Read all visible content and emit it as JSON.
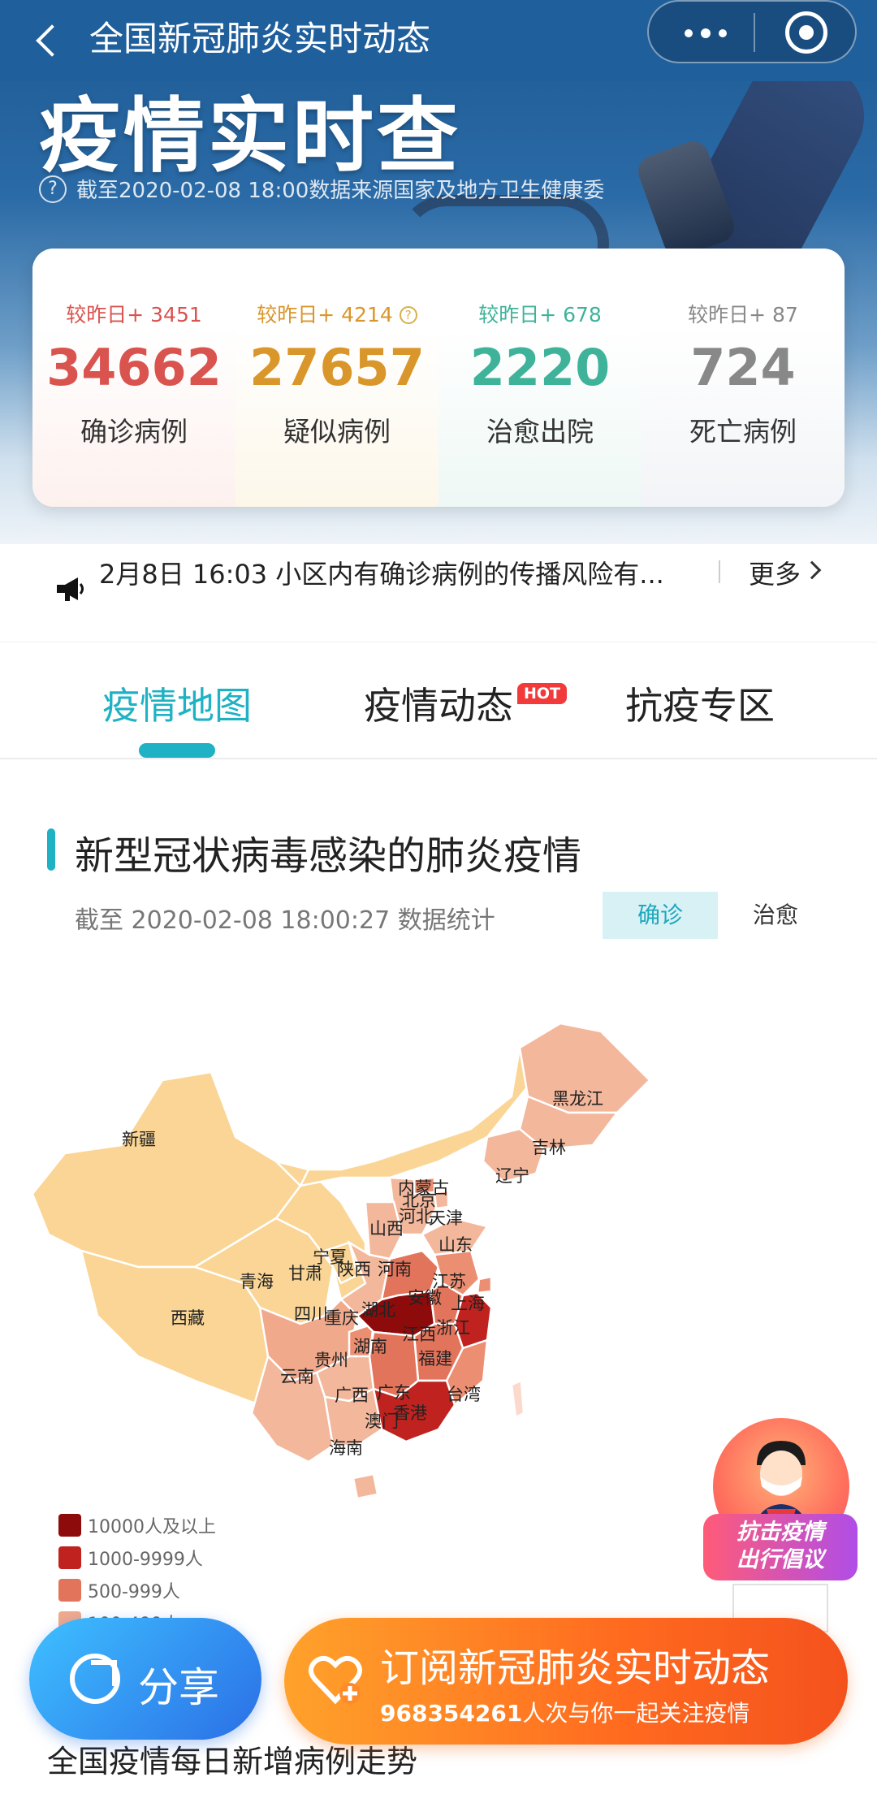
{
  "nav": {
    "title": "全国新冠肺炎实时动态"
  },
  "hero": {
    "title": "疫情实时查",
    "info": "截至2020-02-08 18:00数据来源国家及地方卫生健康委"
  },
  "stats": [
    {
      "delta": "较昨日+ 3451",
      "value": "34662",
      "label": "确诊病例",
      "color": "#d9534f"
    },
    {
      "delta": "较昨日+ 4214",
      "value": "27657",
      "label": "疑似病例",
      "color": "#d9962a"
    },
    {
      "delta": "较昨日+ 678",
      "value": "2220",
      "label": "治愈出院",
      "color": "#3fb39a"
    },
    {
      "delta": "较昨日+ 87",
      "value": "724",
      "label": "死亡病例",
      "color": "#888888"
    }
  ],
  "news": {
    "text": "2月8日 16:03 小区内有确诊病例的传播风险有...",
    "more": "更多"
  },
  "tabs": [
    {
      "label": "疫情地图",
      "active": true
    },
    {
      "label": "疫情动态",
      "badge": "HOT"
    },
    {
      "label": "抗疫专区"
    }
  ],
  "section": {
    "title": "新型冠状病毒感染的肺炎疫情",
    "date": "截至 2020-02-08 18:00:27 数据统计",
    "toggle": [
      "确诊",
      "治愈"
    ]
  },
  "map": {
    "regions": [
      "新疆",
      "西藏",
      "青海",
      "甘肃",
      "宁夏",
      "内蒙古",
      "黑龙江",
      "吉林",
      "辽宁",
      "北京",
      "天津",
      "河北",
      "山西",
      "山东",
      "陕西",
      "河南",
      "江苏",
      "安徽",
      "上海",
      "四川",
      "重庆",
      "湖北",
      "浙江",
      "江西",
      "湖南",
      "福建",
      "贵州",
      "云南",
      "广西",
      "广东",
      "台湾",
      "香港",
      "澳门",
      "海南"
    ],
    "legend": [
      {
        "label": "10000人及以上",
        "color": "#8e0b0b"
      },
      {
        "label": "1000-9999人",
        "color": "#c0221f"
      },
      {
        "label": "500-999人",
        "color": "#e3745c"
      },
      {
        "label": "100-499人",
        "color": "#f1a98c"
      }
    ]
  },
  "campaign": {
    "line1": "抗击疫情",
    "line2": "出行倡议"
  },
  "share": {
    "label": "分享"
  },
  "subscribe": {
    "title": "订阅新冠肺炎实时动态",
    "count": "968354261",
    "suffix": "人次与你一起关注疫情"
  },
  "bottom": {
    "heading": "全国疫情每日新增病例走势"
  }
}
